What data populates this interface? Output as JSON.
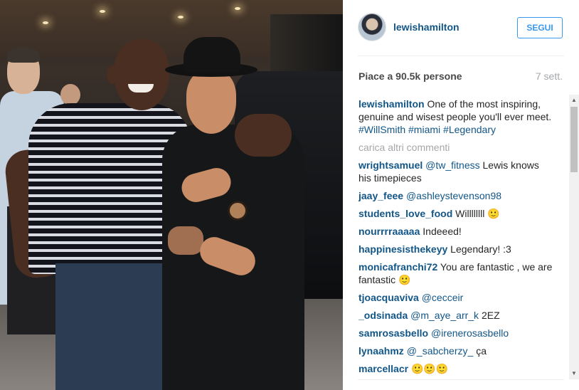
{
  "post": {
    "username": "lewishamilton",
    "follow_label": "SEGUI",
    "likes": "Piace a 90.5k persone",
    "age": "7 sett.",
    "photo_alt": "photo"
  },
  "caption": {
    "user": "lewishamilton",
    "text": "One of the most inspiring, genuine and wisest people you'll ever meet.",
    "hashtags": [
      "#WillSmith",
      "#miami",
      "#Legendary"
    ]
  },
  "load_more": "carica altri commenti",
  "comments": [
    {
      "user": "wrightsamuel",
      "mention": "@tw_fitness",
      "text": "Lewis knows his timepieces"
    },
    {
      "user": "jaay_feee",
      "mention": "@ashleystevenson98",
      "text": ""
    },
    {
      "user": "students_love_food",
      "mention": "",
      "text": "Willllllll 🙂"
    },
    {
      "user": "nourrrraaaaa",
      "mention": "",
      "text": "Indeeed!"
    },
    {
      "user": "happinesisthekeyy",
      "mention": "",
      "text": "Legendary! :3"
    },
    {
      "user": "monicafranchi72",
      "mention": "",
      "text": "You are fantastic , we are fantastic 🙂"
    },
    {
      "user": "tjoacquaviva",
      "mention": "@cecceir",
      "text": ""
    },
    {
      "user": "_odsinada",
      "mention": "@m_aye_arr_k",
      "text": "2EZ"
    },
    {
      "user": "samrosasbello",
      "mention": "@irenerosasbello",
      "text": ""
    },
    {
      "user": "lynaahmz",
      "mention": "@_sabcherzy_",
      "text": "ça"
    },
    {
      "user": "marcellacr",
      "mention": "",
      "text": "🙂🙂🙂"
    }
  ],
  "icons": {
    "scroll_up": "▲",
    "scroll_down": "▼"
  },
  "colors": {
    "link": "#125688",
    "follow": "#3897f0",
    "muted": "#a5a7aa"
  }
}
